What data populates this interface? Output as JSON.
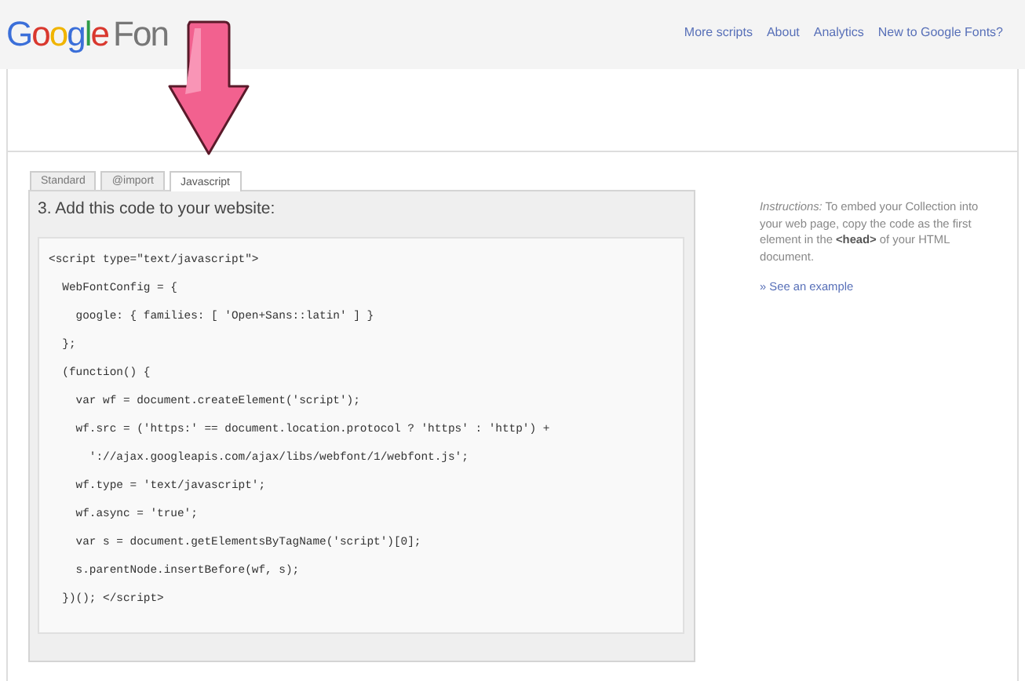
{
  "header": {
    "logo_word": "Google",
    "logo_suffix": "Fon",
    "links": [
      "More scripts",
      "About",
      "Analytics",
      "New to Google Fonts?"
    ]
  },
  "tabs": [
    {
      "label": "Standard",
      "selected": false
    },
    {
      "label": "@import",
      "selected": false
    },
    {
      "label": "Javascript",
      "selected": true
    }
  ],
  "code_panel": {
    "title": "3. Add this code to your website:",
    "lines": [
      "<script type=\"text/javascript\">",
      "  WebFontConfig = {",
      "    google: { families: [ 'Open+Sans::latin' ] }",
      "  };",
      "  (function() {",
      "    var wf = document.createElement('script');",
      "    wf.src = ('https:' == document.location.protocol ? 'https' : 'http') +",
      "      '://ajax.googleapis.com/ajax/libs/webfont/1/webfont.js';",
      "    wf.type = 'text/javascript';",
      "    wf.async = 'true';",
      "    var s = document.getElementsByTagName('script')[0];",
      "    s.parentNode.insertBefore(wf, s);",
      "  })(); </script>"
    ]
  },
  "instructions": {
    "text": "*Instructions:* To embed your Collection into your web page, copy the code as the first element in the **<head>** of your HTML document.",
    "link": "» See an example"
  }
}
